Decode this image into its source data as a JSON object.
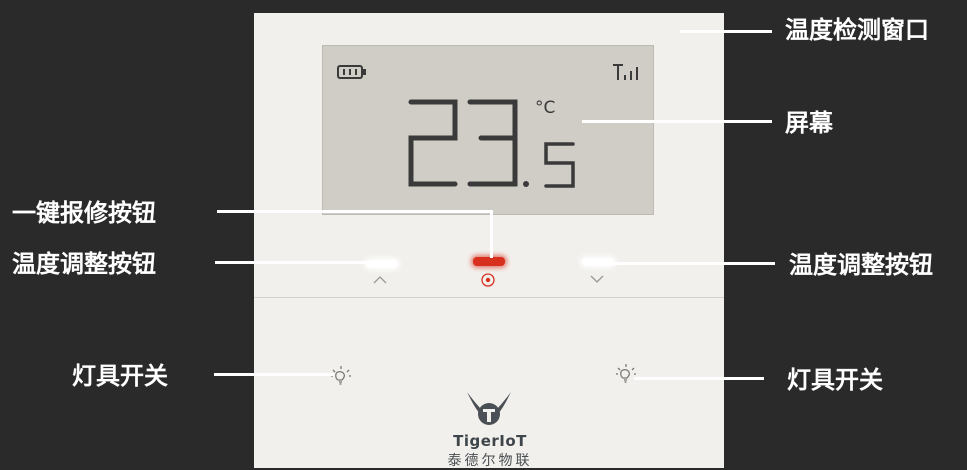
{
  "callouts": {
    "temp_window": "温度检测窗口",
    "screen": "屏幕",
    "repair_button": "一键报修按钮",
    "temp_adjust_left": "温度调整按钮",
    "temp_adjust_right": "温度调整按钮",
    "light_left": "灯具开关",
    "light_right": "灯具开关"
  },
  "display": {
    "temperature_integer": "23",
    "temperature_decimal": "5",
    "unit": "°C",
    "battery_icon": "battery-icon",
    "signal_icon": "signal-icon"
  },
  "brand": {
    "name": "TigerIoT",
    "name_cn": "泰德尔物联"
  },
  "colors": {
    "background": "#2a2a2a",
    "panel": "#f2f0ec",
    "lcd": "#cfcdc6",
    "segment": "#3a3a3a",
    "repair_accent": "#d8301f"
  }
}
